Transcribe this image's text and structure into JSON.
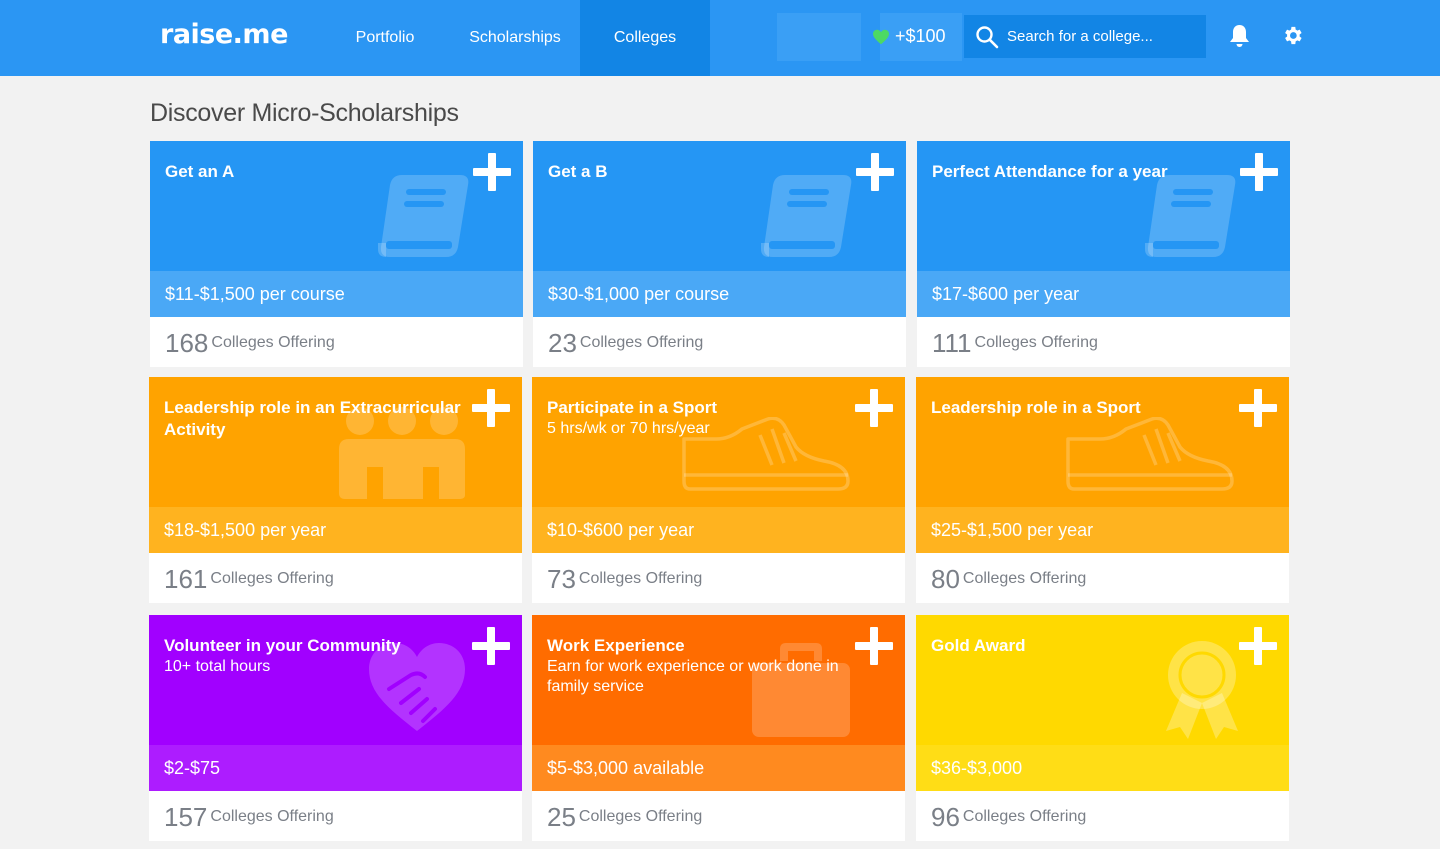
{
  "header": {
    "logo": "raise.me",
    "nav": [
      {
        "label": "Portfolio"
      },
      {
        "label": "Scholarships"
      },
      {
        "label": "Colleges",
        "active": true
      }
    ],
    "points": "+$100",
    "search_placeholder": "Search for a college...",
    "icons": [
      "heart-icon",
      "search-icon",
      "bell-icon",
      "gear-icon"
    ],
    "colors": {
      "bar": "#2b96f3",
      "active": "#1285e5",
      "heart": "#4cd964"
    }
  },
  "page": {
    "title": "Discover Micro-Scholarships"
  },
  "cards": [
    {
      "title": "Get an A",
      "subtitle": "",
      "amount": "$11-$1,500 per course",
      "count": "168",
      "count_label": "Colleges Offering",
      "icon": "book-icon",
      "color": "#2596f4"
    },
    {
      "title": "Get a B",
      "subtitle": "",
      "amount": "$30-$1,000 per course",
      "count": "23",
      "count_label": "Colleges Offering",
      "icon": "book-icon",
      "color": "#2596f4"
    },
    {
      "title": "Perfect Attendance for a year",
      "subtitle": "",
      "amount": "$17-$600 per year",
      "count": "111",
      "count_label": "Colleges Offering",
      "icon": "book-icon",
      "color": "#2596f4"
    },
    {
      "title": "Leadership role in an Extracurricular Activity",
      "subtitle": "",
      "amount": "$18-$1,500 per year",
      "count": "161",
      "count_label": "Colleges Offering",
      "icon": "group-icon",
      "color": "#ffa300"
    },
    {
      "title": "Participate in a Sport",
      "subtitle": "5 hrs/wk or 70 hrs/year",
      "amount": "$10-$600 per year",
      "count": "73",
      "count_label": "Colleges Offering",
      "icon": "sneaker-icon",
      "color": "#ffa300"
    },
    {
      "title": "Leadership role in a Sport",
      "subtitle": "",
      "amount": "$25-$1,500 per year",
      "count": "80",
      "count_label": "Colleges Offering",
      "icon": "sneaker-icon",
      "color": "#ffa300"
    },
    {
      "title": "Volunteer in your Community",
      "subtitle": "10+ total hours",
      "amount": "$2-$75",
      "count": "157",
      "count_label": "Colleges Offering",
      "icon": "heart-hands-icon",
      "color": "#a100ff"
    },
    {
      "title": "Work Experience",
      "subtitle": "Earn for work experience or work done in family service",
      "amount": "$5-$3,000 available",
      "count": "25",
      "count_label": "Colleges Offering",
      "icon": "briefcase-icon",
      "color": "#ff6c00"
    },
    {
      "title": "Gold Award",
      "subtitle": "",
      "amount": "$36-$3,000",
      "count": "96",
      "count_label": "Colleges Offering",
      "icon": "award-ribbon-icon",
      "color": "#ffd900"
    }
  ]
}
